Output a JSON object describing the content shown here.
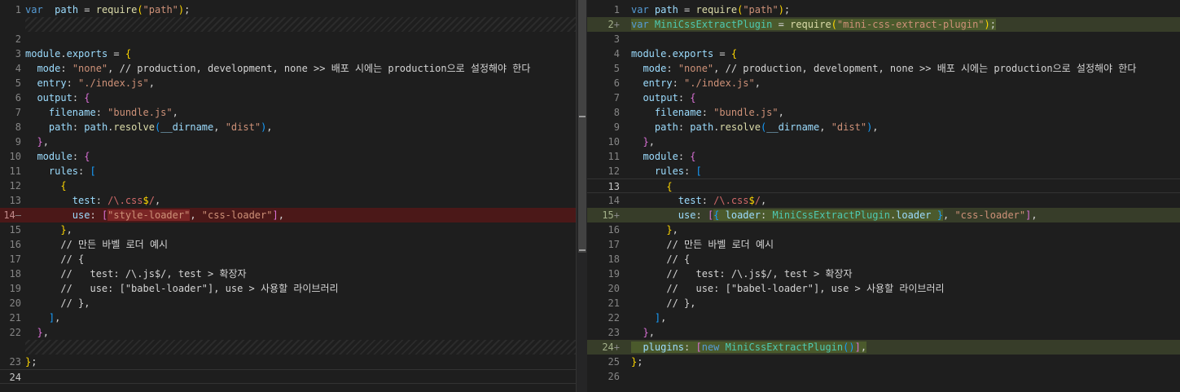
{
  "left": {
    "lines": [
      {
        "ln": "1",
        "mark": "",
        "type": "normal",
        "tokens": [
          [
            "kw",
            "var"
          ],
          [
            "",
            "  "
          ],
          [
            "var",
            "path"
          ],
          [
            "",
            " = "
          ],
          [
            "fn",
            "require"
          ],
          [
            "b1",
            "("
          ],
          [
            "str",
            "\"path\""
          ],
          [
            "b1",
            ")"
          ],
          [
            "",
            ";"
          ]
        ]
      },
      {
        "type": "filler"
      },
      {
        "ln": "2",
        "mark": "",
        "type": "normal",
        "tokens": []
      },
      {
        "ln": "3",
        "mark": "",
        "type": "normal",
        "tokens": [
          [
            "var",
            "module"
          ],
          [
            "",
            "."
          ],
          [
            "var",
            "exports"
          ],
          [
            "",
            " = "
          ],
          [
            "b1",
            "{"
          ]
        ]
      },
      {
        "ln": "4",
        "mark": "",
        "type": "normal",
        "tokens": [
          [
            "",
            "  "
          ],
          [
            "var",
            "mode"
          ],
          [
            "",
            ": "
          ],
          [
            "str",
            "\"none\""
          ],
          [
            "",
            ", // production, development, none >> 배포 시에는 production으로 설정해야 한다"
          ]
        ]
      },
      {
        "ln": "5",
        "mark": "",
        "type": "normal",
        "tokens": [
          [
            "",
            "  "
          ],
          [
            "var",
            "entry"
          ],
          [
            "",
            ": "
          ],
          [
            "str",
            "\"./index.js\""
          ],
          [
            "",
            ","
          ]
        ]
      },
      {
        "ln": "6",
        "mark": "",
        "type": "normal",
        "tokens": [
          [
            "",
            "  "
          ],
          [
            "var",
            "output"
          ],
          [
            "",
            ": "
          ],
          [
            "b2",
            "{"
          ]
        ]
      },
      {
        "ln": "7",
        "mark": "",
        "type": "normal",
        "tokens": [
          [
            "",
            "    "
          ],
          [
            "var",
            "filename"
          ],
          [
            "",
            ": "
          ],
          [
            "str",
            "\"bundle.js\""
          ],
          [
            "",
            ","
          ]
        ]
      },
      {
        "ln": "8",
        "mark": "",
        "type": "normal",
        "tokens": [
          [
            "",
            "    "
          ],
          [
            "var",
            "path"
          ],
          [
            "",
            ": "
          ],
          [
            "var",
            "path"
          ],
          [
            "",
            "."
          ],
          [
            "fn",
            "resolve"
          ],
          [
            "b3",
            "("
          ],
          [
            "var",
            "__dirname"
          ],
          [
            "",
            ", "
          ],
          [
            "str",
            "\"dist\""
          ],
          [
            "b3",
            ")"
          ],
          [
            "",
            ","
          ]
        ]
      },
      {
        "ln": "9",
        "mark": "",
        "type": "normal",
        "tokens": [
          [
            "",
            "  "
          ],
          [
            "b2",
            "}"
          ],
          [
            "",
            ","
          ]
        ]
      },
      {
        "ln": "10",
        "mark": "",
        "type": "normal",
        "tokens": [
          [
            "",
            "  "
          ],
          [
            "var",
            "module"
          ],
          [
            "",
            ": "
          ],
          [
            "b2",
            "{"
          ]
        ]
      },
      {
        "ln": "11",
        "mark": "",
        "type": "normal",
        "tokens": [
          [
            "",
            "    "
          ],
          [
            "var",
            "rules"
          ],
          [
            "",
            ": "
          ],
          [
            "b3",
            "["
          ]
        ]
      },
      {
        "ln": "12",
        "mark": "",
        "type": "normal",
        "tokens": [
          [
            "",
            "      "
          ],
          [
            "b1",
            "{"
          ]
        ]
      },
      {
        "ln": "13",
        "mark": "",
        "type": "normal",
        "tokens": [
          [
            "",
            "        "
          ],
          [
            "var",
            "test"
          ],
          [
            "",
            ": "
          ],
          [
            "rx",
            "/\\.css"
          ],
          [
            "b1",
            "$"
          ],
          [
            "rx",
            "/"
          ],
          [
            "",
            ","
          ]
        ]
      },
      {
        "ln": "14",
        "mark": "—",
        "type": "removed",
        "tokens": [
          [
            "",
            "        "
          ],
          [
            "var",
            "use"
          ],
          [
            "",
            ": "
          ],
          [
            "b2",
            "["
          ],
          [
            "hl-del str",
            "\"style-loader\""
          ],
          [
            "",
            ", "
          ],
          [
            "str",
            "\"css-loader\""
          ],
          [
            "b2",
            "]"
          ],
          [
            "",
            ","
          ]
        ]
      },
      {
        "ln": "15",
        "mark": "",
        "type": "normal",
        "tokens": [
          [
            "",
            "      "
          ],
          [
            "b1",
            "}"
          ],
          [
            "",
            ","
          ]
        ]
      },
      {
        "ln": "16",
        "mark": "",
        "type": "normal",
        "tokens": [
          [
            "",
            "      "
          ],
          [
            "cmt",
            "// 만든 바벨 로더 예시"
          ]
        ]
      },
      {
        "ln": "17",
        "mark": "",
        "type": "normal",
        "tokens": [
          [
            "",
            "      "
          ],
          [
            "cmt",
            "// {"
          ]
        ]
      },
      {
        "ln": "18",
        "mark": "",
        "type": "normal",
        "tokens": [
          [
            "",
            "      "
          ],
          [
            "cmt",
            "//   test: /\\.js$/, test > 확장자"
          ]
        ]
      },
      {
        "ln": "19",
        "mark": "",
        "type": "normal",
        "tokens": [
          [
            "",
            "      "
          ],
          [
            "cmt",
            "//   use: [\"babel-loader\"], use > 사용할 라이브러리"
          ]
        ]
      },
      {
        "ln": "20",
        "mark": "",
        "type": "normal",
        "tokens": [
          [
            "",
            "      "
          ],
          [
            "cmt",
            "// },"
          ]
        ]
      },
      {
        "ln": "21",
        "mark": "",
        "type": "normal",
        "tokens": [
          [
            "",
            "    "
          ],
          [
            "b3",
            "]"
          ],
          [
            "",
            ","
          ]
        ]
      },
      {
        "ln": "22",
        "mark": "",
        "type": "normal",
        "tokens": [
          [
            "",
            "  "
          ],
          [
            "b2",
            "}"
          ],
          [
            "",
            ","
          ]
        ]
      },
      {
        "type": "filler"
      },
      {
        "ln": "23",
        "mark": "",
        "type": "normal",
        "tokens": [
          [
            "b1",
            "}"
          ],
          [
            "",
            ";"
          ]
        ]
      },
      {
        "ln": "24",
        "mark": "",
        "type": "cursor",
        "tokens": []
      }
    ]
  },
  "right": {
    "lines": [
      {
        "ln": "1",
        "mark": "",
        "type": "normal",
        "tokens": [
          [
            "kw",
            "var"
          ],
          [
            "",
            " "
          ],
          [
            "var",
            "path"
          ],
          [
            "",
            " = "
          ],
          [
            "fn",
            "require"
          ],
          [
            "b1",
            "("
          ],
          [
            "str",
            "\"path\""
          ],
          [
            "b1",
            ")"
          ],
          [
            "",
            ";"
          ]
        ]
      },
      {
        "ln": "2",
        "mark": "+",
        "type": "added",
        "tokens": [
          [
            "hl kw",
            "var "
          ],
          [
            "hl cls",
            "MiniCssExtractPlugin"
          ],
          [
            "hl",
            " = "
          ],
          [
            "hl fn",
            "require"
          ],
          [
            "hl b1",
            "("
          ],
          [
            "hl str",
            "\"mini-css-extract-plugin\""
          ],
          [
            "hl b1",
            ")"
          ],
          [
            "hl",
            ";"
          ]
        ]
      },
      {
        "ln": "3",
        "mark": "",
        "type": "normal",
        "tokens": []
      },
      {
        "ln": "4",
        "mark": "",
        "type": "normal",
        "tokens": [
          [
            "var",
            "module"
          ],
          [
            "",
            "."
          ],
          [
            "var",
            "exports"
          ],
          [
            "",
            " = "
          ],
          [
            "b1",
            "{"
          ]
        ]
      },
      {
        "ln": "5",
        "mark": "",
        "type": "normal",
        "tokens": [
          [
            "",
            "  "
          ],
          [
            "var",
            "mode"
          ],
          [
            "",
            ": "
          ],
          [
            "str",
            "\"none\""
          ],
          [
            "",
            ", // production, development, none >> 배포 시에는 production으로 설정해야 한다"
          ]
        ]
      },
      {
        "ln": "6",
        "mark": "",
        "type": "normal",
        "tokens": [
          [
            "",
            "  "
          ],
          [
            "var",
            "entry"
          ],
          [
            "",
            ": "
          ],
          [
            "str",
            "\"./index.js\""
          ],
          [
            "",
            ","
          ]
        ]
      },
      {
        "ln": "7",
        "mark": "",
        "type": "normal",
        "tokens": [
          [
            "",
            "  "
          ],
          [
            "var",
            "output"
          ],
          [
            "",
            ": "
          ],
          [
            "b2",
            "{"
          ]
        ]
      },
      {
        "ln": "8",
        "mark": "",
        "type": "normal",
        "tokens": [
          [
            "",
            "    "
          ],
          [
            "var",
            "filename"
          ],
          [
            "",
            ": "
          ],
          [
            "str",
            "\"bundle.js\""
          ],
          [
            "",
            ","
          ]
        ]
      },
      {
        "ln": "9",
        "mark": "",
        "type": "normal",
        "tokens": [
          [
            "",
            "    "
          ],
          [
            "var",
            "path"
          ],
          [
            "",
            ": "
          ],
          [
            "var",
            "path"
          ],
          [
            "",
            "."
          ],
          [
            "fn",
            "resolve"
          ],
          [
            "b3",
            "("
          ],
          [
            "var",
            "__dirname"
          ],
          [
            "",
            ", "
          ],
          [
            "str",
            "\"dist\""
          ],
          [
            "b3",
            ")"
          ],
          [
            "",
            ","
          ]
        ]
      },
      {
        "ln": "10",
        "mark": "",
        "type": "normal",
        "tokens": [
          [
            "",
            "  "
          ],
          [
            "b2",
            "}"
          ],
          [
            "",
            ","
          ]
        ]
      },
      {
        "ln": "11",
        "mark": "",
        "type": "normal",
        "tokens": [
          [
            "",
            "  "
          ],
          [
            "var",
            "module"
          ],
          [
            "",
            ": "
          ],
          [
            "b2",
            "{"
          ]
        ]
      },
      {
        "ln": "12",
        "mark": "",
        "type": "normal",
        "tokens": [
          [
            "",
            "    "
          ],
          [
            "var",
            "rules"
          ],
          [
            "",
            ": "
          ],
          [
            "b3",
            "["
          ]
        ]
      },
      {
        "ln": "13",
        "mark": "",
        "type": "cursor",
        "tokens": [
          [
            "",
            "      "
          ],
          [
            "b1",
            "{"
          ]
        ]
      },
      {
        "ln": "14",
        "mark": "",
        "type": "normal",
        "tokens": [
          [
            "",
            "        "
          ],
          [
            "var",
            "test"
          ],
          [
            "",
            ": "
          ],
          [
            "rx",
            "/\\.css"
          ],
          [
            "b1",
            "$"
          ],
          [
            "rx",
            "/"
          ],
          [
            "",
            ","
          ]
        ]
      },
      {
        "ln": "15",
        "mark": "+",
        "type": "added",
        "tokens": [
          [
            "",
            "        "
          ],
          [
            "var",
            "use"
          ],
          [
            "",
            ": "
          ],
          [
            "b2",
            "["
          ],
          [
            "hl b3",
            "{"
          ],
          [
            "hl var",
            " loader"
          ],
          [
            "hl",
            ": "
          ],
          [
            "hl cls",
            "MiniCssExtractPlugin"
          ],
          [
            "hl",
            "."
          ],
          [
            "hl var",
            "loader"
          ],
          [
            "hl b3",
            " }"
          ],
          [
            "",
            ", "
          ],
          [
            "str",
            "\"css-loader\""
          ],
          [
            "b2",
            "]"
          ],
          [
            "",
            ","
          ]
        ]
      },
      {
        "ln": "16",
        "mark": "",
        "type": "normal",
        "tokens": [
          [
            "",
            "      "
          ],
          [
            "b1",
            "}"
          ],
          [
            "",
            ","
          ]
        ]
      },
      {
        "ln": "17",
        "mark": "",
        "type": "normal",
        "tokens": [
          [
            "",
            "      "
          ],
          [
            "cmt",
            "// 만든 바벨 로더 예시"
          ]
        ]
      },
      {
        "ln": "18",
        "mark": "",
        "type": "normal",
        "tokens": [
          [
            "",
            "      "
          ],
          [
            "cmt",
            "// {"
          ]
        ]
      },
      {
        "ln": "19",
        "mark": "",
        "type": "normal",
        "tokens": [
          [
            "",
            "      "
          ],
          [
            "cmt",
            "//   test: /\\.js$/, test > 확장자"
          ]
        ]
      },
      {
        "ln": "20",
        "mark": "",
        "type": "normal",
        "tokens": [
          [
            "",
            "      "
          ],
          [
            "cmt",
            "//   use: [\"babel-loader\"], use > 사용할 라이브러리"
          ]
        ]
      },
      {
        "ln": "21",
        "mark": "",
        "type": "normal",
        "tokens": [
          [
            "",
            "      "
          ],
          [
            "cmt",
            "// },"
          ]
        ]
      },
      {
        "ln": "22",
        "mark": "",
        "type": "normal",
        "tokens": [
          [
            "",
            "    "
          ],
          [
            "b3",
            "]"
          ],
          [
            "",
            ","
          ]
        ]
      },
      {
        "ln": "23",
        "mark": "",
        "type": "normal",
        "tokens": [
          [
            "",
            "  "
          ],
          [
            "b2",
            "}"
          ],
          [
            "",
            ","
          ]
        ]
      },
      {
        "ln": "24",
        "mark": "+",
        "type": "added",
        "tokens": [
          [
            "hl",
            "  "
          ],
          [
            "hl var",
            "plugins"
          ],
          [
            "hl",
            ": "
          ],
          [
            "hl b2",
            "["
          ],
          [
            "hl kw",
            "new "
          ],
          [
            "hl cls",
            "MiniCssExtractPlugin"
          ],
          [
            "hl b3",
            "()"
          ],
          [
            "hl b2",
            "]"
          ],
          [
            "hl",
            ","
          ]
        ]
      },
      {
        "ln": "25",
        "mark": "",
        "type": "normal",
        "tokens": [
          [
            "b1",
            "}"
          ],
          [
            "",
            ";"
          ]
        ]
      },
      {
        "ln": "26",
        "mark": "",
        "type": "normal",
        "tokens": []
      }
    ]
  }
}
